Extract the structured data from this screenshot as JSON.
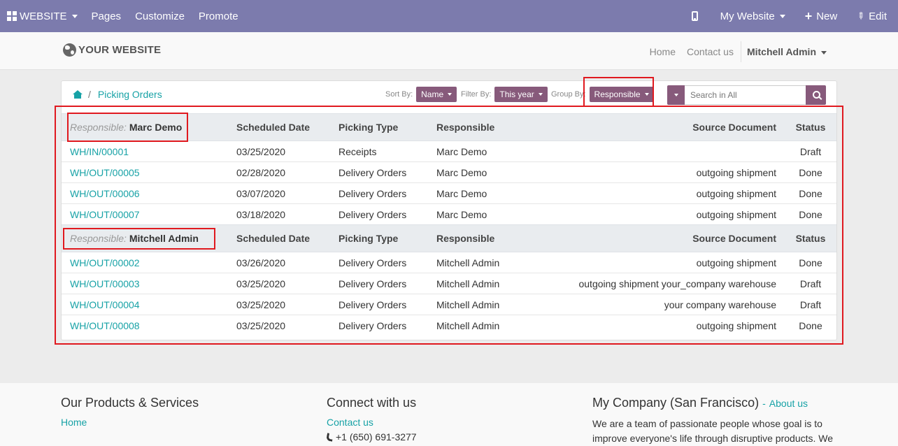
{
  "admin_bar": {
    "website_menu": "WEBSITE",
    "links": [
      "Pages",
      "Customize",
      "Promote"
    ],
    "website_switcher": "My Website",
    "new_label": "New",
    "edit_label": "Edit"
  },
  "site_header": {
    "logo_text": "YOUR WEBSITE",
    "nav": [
      "Home",
      "Contact us"
    ],
    "user": "Mitchell Admin"
  },
  "breadcrumb": {
    "current": "Picking Orders",
    "separator": "/"
  },
  "controls": {
    "sort_label": "Sort By:",
    "sort_value": "Name",
    "filter_label": "Filter By:",
    "filter_value": "This year",
    "group_label": "Group By:",
    "group_value": "Responsible",
    "search_placeholder": "Search in All"
  },
  "table": {
    "columns": [
      "Scheduled Date",
      "Picking Type",
      "Responsible",
      "Source Document",
      "Status"
    ],
    "group_prefix": "Responsible:",
    "groups": [
      {
        "name": "Marc Demo",
        "rows": [
          {
            "ref": "WH/IN/00001",
            "date": "03/25/2020",
            "type": "Receipts",
            "responsible": "Marc Demo",
            "source": "",
            "status": "Draft"
          },
          {
            "ref": "WH/OUT/00005",
            "date": "02/28/2020",
            "type": "Delivery Orders",
            "responsible": "Marc Demo",
            "source": "outgoing shipment",
            "status": "Done"
          },
          {
            "ref": "WH/OUT/00006",
            "date": "03/07/2020",
            "type": "Delivery Orders",
            "responsible": "Marc Demo",
            "source": "outgoing shipment",
            "status": "Done"
          },
          {
            "ref": "WH/OUT/00007",
            "date": "03/18/2020",
            "type": "Delivery Orders",
            "responsible": "Marc Demo",
            "source": "outgoing shipment",
            "status": "Done"
          }
        ]
      },
      {
        "name": "Mitchell Admin",
        "rows": [
          {
            "ref": "WH/OUT/00002",
            "date": "03/26/2020",
            "type": "Delivery Orders",
            "responsible": "Mitchell Admin",
            "source": "outgoing shipment",
            "status": "Done"
          },
          {
            "ref": "WH/OUT/00003",
            "date": "03/25/2020",
            "type": "Delivery Orders",
            "responsible": "Mitchell Admin",
            "source": "outgoing shipment your_company warehouse",
            "status": "Draft"
          },
          {
            "ref": "WH/OUT/00004",
            "date": "03/25/2020",
            "type": "Delivery Orders",
            "responsible": "Mitchell Admin",
            "source": "your company warehouse",
            "status": "Draft"
          },
          {
            "ref": "WH/OUT/00008",
            "date": "03/25/2020",
            "type": "Delivery Orders",
            "responsible": "Mitchell Admin",
            "source": "outgoing shipment",
            "status": "Done"
          }
        ]
      }
    ]
  },
  "footer": {
    "products_title": "Our Products & Services",
    "products_link": "Home",
    "connect_title": "Connect with us",
    "connect_link": "Contact us",
    "phone": "+1 (650) 691-3277",
    "company_title": "My Company (San Francisco)",
    "company_sep": "-",
    "about_link": "About us",
    "about_text": "We are a team of passionate people whose goal is to improve everyone's life through disruptive products. We"
  },
  "colors": {
    "admin_bar": "#7c7bad",
    "accent": "#17a2a6",
    "button": "#875a7b",
    "annotation": "#e0191f"
  },
  "icons": [
    "apps-grid-icon",
    "mobile-icon",
    "plus-icon",
    "pencil-icon",
    "globe-icon",
    "home-icon",
    "search-icon",
    "phone-icon"
  ]
}
